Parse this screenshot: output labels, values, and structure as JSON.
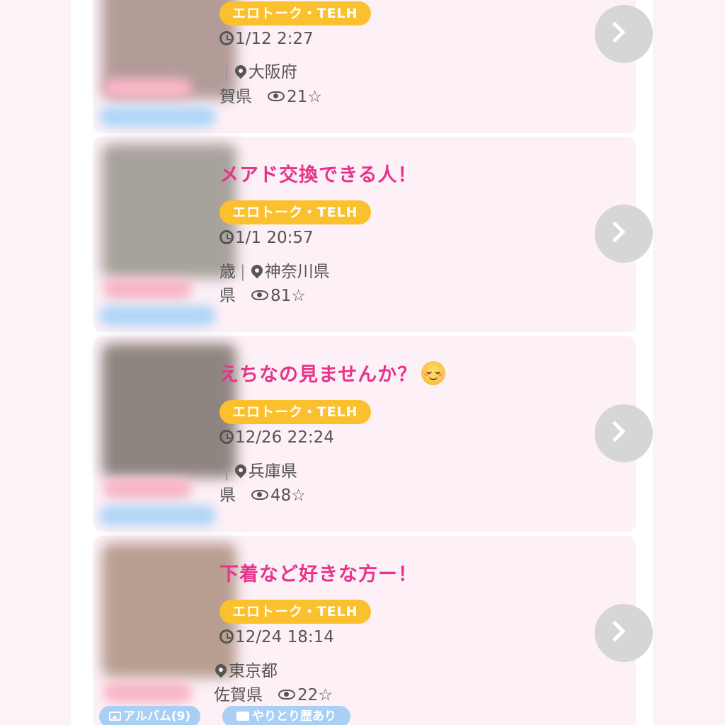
{
  "posts": [
    {
      "title": "",
      "tag": "エロトーク・TELH",
      "datetime": "1/12 2:27",
      "age_partial": "",
      "prefecture": "大阪府",
      "home_partial": "賀県",
      "views": "21",
      "thumb_color": "#b39c98"
    },
    {
      "title": "メアド交換できる人！",
      "tag": "エロトーク・TELH",
      "datetime": "1/1 20:57",
      "age_partial": "歳",
      "prefecture": "神奈川県",
      "home_partial": "県",
      "views": "81",
      "thumb_color": "#a8a29c"
    },
    {
      "title": "えちなの見ませんか？",
      "tag": "エロトーク・TELH",
      "datetime": "12/26 22:24",
      "age_partial": "",
      "prefecture": "兵庫県",
      "home_partial": "県",
      "views": "48",
      "thumb_color": "#8f8580"
    },
    {
      "title": "下着など好きな方ー！",
      "tag": "エロトーク・TELH",
      "datetime": "12/24 18:14",
      "age_partial": "",
      "prefecture": "東京都",
      "home_partial": "佐賀県",
      "views": "22",
      "thumb_color": "#b79e90"
    }
  ],
  "star_glyph": "☆",
  "badges": {
    "album": "アルバム(9)",
    "history": "やりとり歴あり"
  },
  "colors": {
    "title": "#e7338a",
    "tag_bg": "#fbc02d",
    "card_bg": "#fdf0f7",
    "badge_blue": "#a9cff5"
  }
}
